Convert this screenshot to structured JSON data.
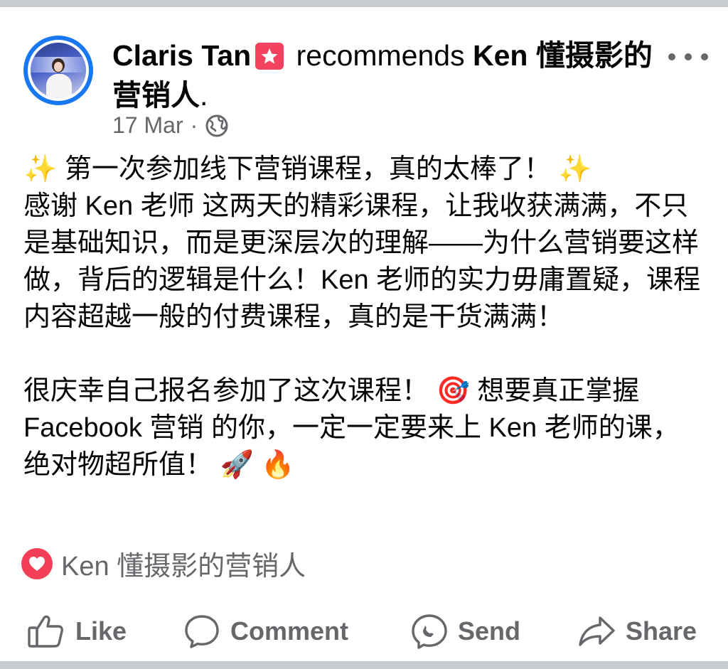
{
  "post": {
    "author": "Claris Tan",
    "verb": "recommends",
    "page": "Ken 懂摄影的营销人",
    "trail": ".",
    "date": "17 Mar",
    "separator": "·",
    "body": [
      "✨ 第一次参加线下营销课程，真的太棒了！ ✨",
      "感谢 Ken 老师 这两天的精彩课程，让我收获满满，不只是基础知识，而是更深层次的理解——为什么营销要这样做，背后的逻辑是什么！Ken 老师的实力毋庸置疑，课程内容超越一般的付费课程，真的是干货满满！",
      "很庆幸自己报名参加了这次课程！ 🎯 想要真正掌握 Facebook 营销 的你，一定一定要来上 Ken 老师的课，绝对物超所值！ 🚀 🔥"
    ],
    "reacted_by": "Ken 懂摄影的营销人"
  },
  "actions": {
    "like": "Like",
    "comment": "Comment",
    "send": "Send",
    "share": "Share"
  },
  "icons": {
    "badge": "recommend-star-icon",
    "audience": "globe-icon",
    "reaction": "heart-icon",
    "more": "more-options-icon"
  },
  "colors": {
    "brand_blue": "#1877f2",
    "secondary_text": "#65676b",
    "recommend_red": "#f3425f",
    "heart": "#f33e58"
  }
}
